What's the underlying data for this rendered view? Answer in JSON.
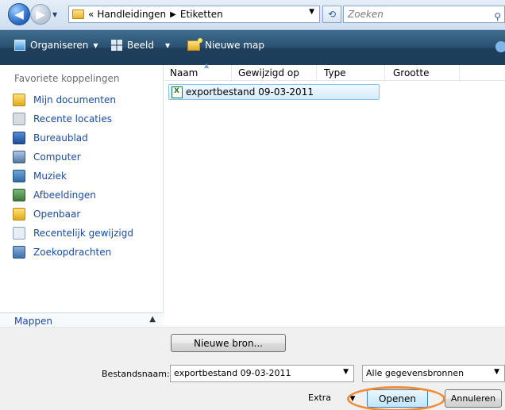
{
  "address": {
    "parent": "Handleidingen",
    "current": "Etiketten",
    "search_placeholder": "Zoeken"
  },
  "toolbar": {
    "organize": "Organiseren",
    "view": "Beeld",
    "new_folder": "Nieuwe map"
  },
  "sidebar": {
    "favorites_title": "Favoriete koppelingen",
    "items": [
      {
        "label": "Mijn documenten",
        "icon": "folder-icon"
      },
      {
        "label": "Recente locaties",
        "icon": "recent-places-icon"
      },
      {
        "label": "Bureaublad",
        "icon": "desktop-icon"
      },
      {
        "label": "Computer",
        "icon": "computer-icon"
      },
      {
        "label": "Muziek",
        "icon": "music-icon"
      },
      {
        "label": "Afbeeldingen",
        "icon": "pictures-icon"
      },
      {
        "label": "Openbaar",
        "icon": "folder-icon"
      },
      {
        "label": "Recentelijk gewijzigd",
        "icon": "recently-changed-icon"
      },
      {
        "label": "Zoekopdrachten",
        "icon": "searches-icon"
      }
    ],
    "folders_label": "Mappen"
  },
  "filelist": {
    "columns": [
      "Naam",
      "Gewijzigd op",
      "Type",
      "Grootte"
    ],
    "rows": [
      {
        "name": "exportbestand 09-03-2011",
        "icon": "excel-file-icon",
        "selected": true
      }
    ]
  },
  "bottom": {
    "new_source_button": "Nieuwe bron...",
    "filename_label": "Bestandsnaam:",
    "filename_value": "exportbestand 09-03-2011",
    "filetype_value": "Alle gegevensbronnen",
    "extra_label": "Extra",
    "open_button": "Openen",
    "cancel_button": "Annuleren",
    "highlight_color": "#f08a34"
  }
}
